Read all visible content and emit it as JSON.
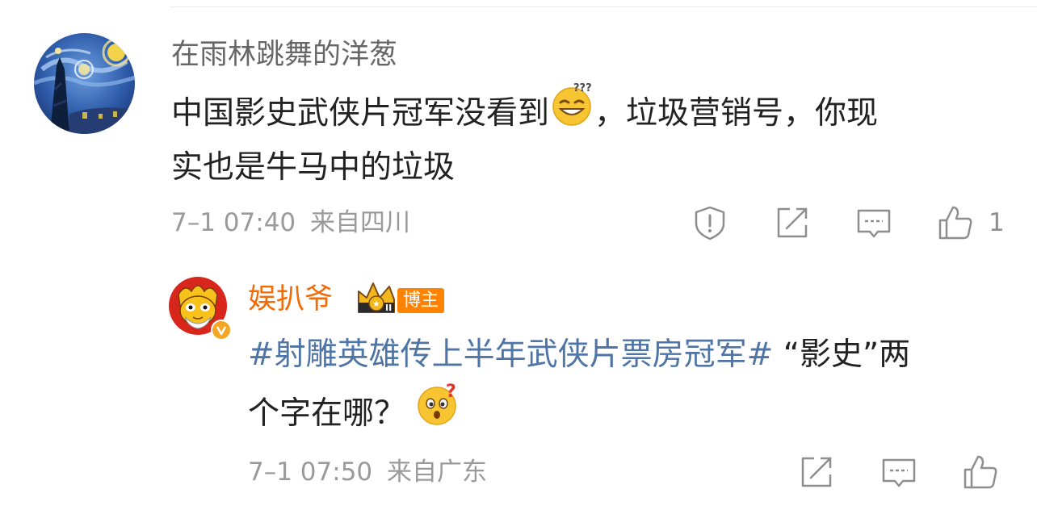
{
  "comment": {
    "username": "在雨林跳舞的洋葱",
    "text_line1_part1": "中国影史武侠片冠军没看到",
    "text_line1_part2": "，垃圾营销号，你现",
    "text_line2": "实也是牛马中的垃圾",
    "time": "7–1 07:40",
    "location": "来自四川",
    "like_count": "1",
    "emoji": "dizzy-grin-emoji"
  },
  "reply": {
    "username": "娱扒爷",
    "badge": "博主",
    "hashtag": "#射雕英雄传上半年武侠片票房冠军#",
    "text_line1_rest": " “影史”两",
    "text_line2": "个字在哪？ ",
    "time": "7–1 07:50",
    "location": "来自广东",
    "emoji": "confused-question-emoji"
  },
  "colors": {
    "username_gray": "#666666",
    "vip_orange": "#f26b08",
    "hashtag_blue": "#4f74a6",
    "meta_gray": "#9a9a9a",
    "badge_orange": "#ff8200"
  },
  "icons": [
    "report-icon",
    "repost-icon",
    "comment-icon",
    "like-icon"
  ]
}
